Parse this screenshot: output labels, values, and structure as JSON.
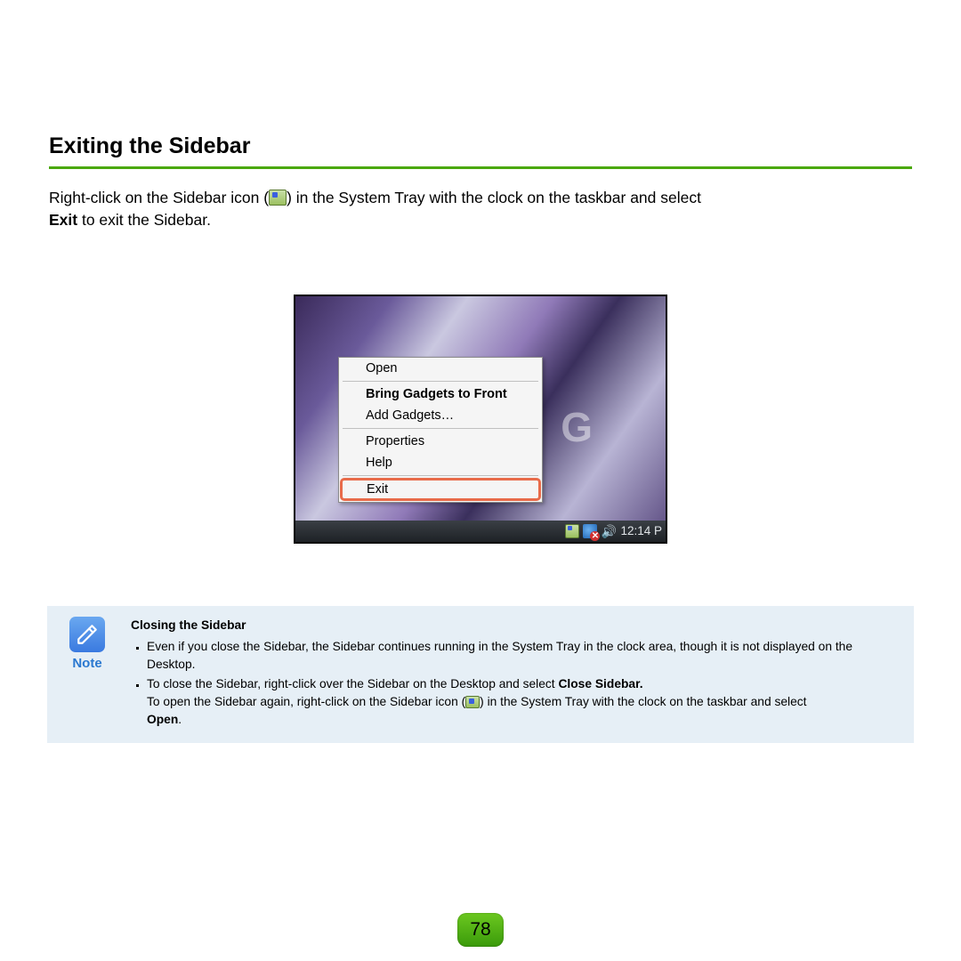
{
  "heading": "Exiting the Sidebar",
  "intro": {
    "part1": "Right-click on the Sidebar icon (",
    "part2": ") in the System Tray with the clock on the taskbar and select",
    "part3_bold": "Exit",
    "part4": " to exit the Sidebar."
  },
  "contextMenu": {
    "open": "Open",
    "bring": "Bring Gadgets to Front",
    "add": "Add Gadgets…",
    "properties": "Properties",
    "help": "Help",
    "exit": "Exit"
  },
  "taskbar": {
    "time": "12:14 P",
    "brand": "G"
  },
  "note": {
    "label": "Note",
    "heading": "Closing the Sidebar",
    "bullet1": "Even if you close the Sidebar, the Sidebar continues running in the System Tray in the clock area, though it is not displayed on the Desktop.",
    "bullet2a": "To close the Sidebar, right-click over the Sidebar on the Desktop and select ",
    "bullet2b_bold": "Close Sidebar.",
    "bullet2c": "To open the Sidebar again, right-click on the Sidebar icon (",
    "bullet2d": ") in the System Tray with the clock on the taskbar and select ",
    "bullet2e_bold": "Open",
    "bullet2f": "."
  },
  "pageNumber": "78"
}
